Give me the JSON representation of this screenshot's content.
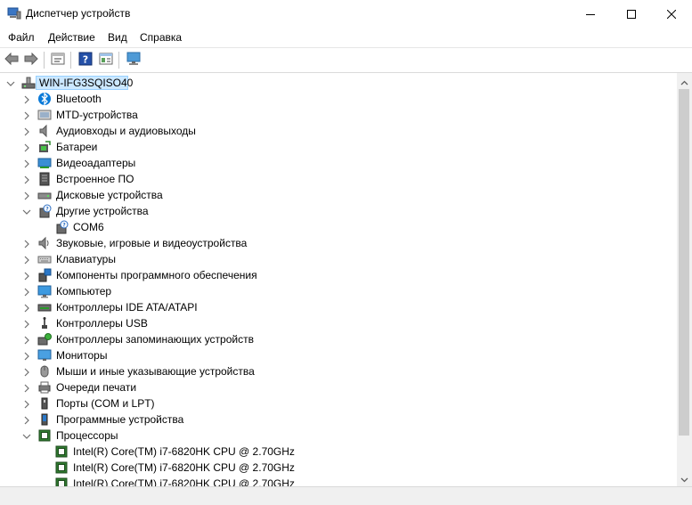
{
  "window": {
    "title": "Диспетчер устройств",
    "controls": {
      "minimize_icon": "minimize-icon",
      "maximize_icon": "maximize-icon",
      "close_icon": "close-icon"
    }
  },
  "menu": [
    "Файл",
    "Действие",
    "Вид",
    "Справка"
  ],
  "toolbar": {
    "buttons": [
      "back-arrow-icon",
      "forward-arrow-icon",
      "properties-icon",
      "help-icon",
      "view-icon",
      "monitor-icon"
    ]
  },
  "tree": {
    "root": "WIN-IFG3SQISO40",
    "categories": [
      {
        "label": "Bluetooth",
        "icon": "bluetooth-icon",
        "expanded": false
      },
      {
        "label": "MTD-устройства",
        "icon": "mtd-device-icon",
        "expanded": false
      },
      {
        "label": "Аудиовходы и аудиовыходы",
        "icon": "speaker-icon",
        "expanded": false
      },
      {
        "label": "Батареи",
        "icon": "battery-icon",
        "expanded": false
      },
      {
        "label": "Видеоадаптеры",
        "icon": "display-adapter-icon",
        "expanded": false
      },
      {
        "label": "Встроенное ПО",
        "icon": "firmware-icon",
        "expanded": false
      },
      {
        "label": "Дисковые устройства",
        "icon": "disk-drive-icon",
        "expanded": false
      },
      {
        "label": "Другие устройства",
        "icon": "unknown-device-icon",
        "expanded": true,
        "children": [
          "COM6"
        ]
      },
      {
        "label": "Звуковые, игровые и видеоустройства",
        "icon": "sound-icon",
        "expanded": false
      },
      {
        "label": "Клавиатуры",
        "icon": "keyboard-icon",
        "expanded": false
      },
      {
        "label": "Компоненты программного обеспечения",
        "icon": "software-component-icon",
        "expanded": false
      },
      {
        "label": "Компьютер",
        "icon": "computer-icon",
        "expanded": false
      },
      {
        "label": "Контроллеры IDE ATA/ATAPI",
        "icon": "ide-controller-icon",
        "expanded": false
      },
      {
        "label": "Контроллеры USB",
        "icon": "usb-icon",
        "expanded": false
      },
      {
        "label": "Контроллеры запоминающих устройств",
        "icon": "storage-controller-icon",
        "expanded": false
      },
      {
        "label": "Мониторы",
        "icon": "monitor-icon",
        "expanded": false
      },
      {
        "label": "Мыши и иные указывающие устройства",
        "icon": "mouse-icon",
        "expanded": false
      },
      {
        "label": "Очереди печати",
        "icon": "printer-icon",
        "expanded": false
      },
      {
        "label": "Порты (COM и LPT)",
        "icon": "port-icon",
        "expanded": false
      },
      {
        "label": "Программные устройства",
        "icon": "software-device-icon",
        "expanded": false
      },
      {
        "label": "Процессоры",
        "icon": "processor-icon",
        "expanded": true,
        "children": [
          "Intel(R) Core(TM) i7-6820HK CPU @ 2.70GHz",
          "Intel(R) Core(TM) i7-6820HK CPU @ 2.70GHz",
          "Intel(R) Core(TM) i7-6820HK CPU @ 2.70GHz"
        ]
      }
    ]
  },
  "colors": {
    "selection": "#cce8ff",
    "selection_border": "#99d1ff",
    "chevron": "#6e6e6e",
    "bluetooth": "#0a7ad8",
    "cpu_green": "#2f7a2f"
  }
}
